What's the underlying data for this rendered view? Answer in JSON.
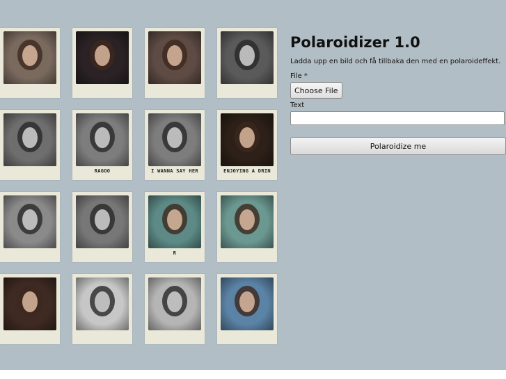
{
  "app": {
    "title": "Polaroidizer 1.0",
    "description": "Ladda upp en bild och få tillbaka den med en polaroideffekt."
  },
  "form": {
    "file_label": "File *",
    "choose_file_label": "Choose File",
    "text_label": "Text",
    "text_value": "",
    "submit_label": "Polaroidize me"
  },
  "gallery": [
    {
      "caption": "",
      "bg": "#7a6a5e",
      "mono": false
    },
    {
      "caption": "",
      "bg": "#2a2224",
      "mono": false
    },
    {
      "caption": "",
      "bg": "#5e4b44",
      "mono": false
    },
    {
      "caption": "",
      "bg": "#5a5a5a",
      "mono": true
    },
    {
      "caption": "",
      "bg": "#6e6e6e",
      "mono": true
    },
    {
      "caption": "RAGOO",
      "bg": "#7d7d7d",
      "mono": true
    },
    {
      "caption": "I WANNA SAY HER",
      "bg": "#7d7d7d",
      "mono": true
    },
    {
      "caption": "ENJOYING A DRIN",
      "bg": "#2c2018",
      "mono": false
    },
    {
      "caption": "",
      "bg": "#8a8a8a",
      "mono": true
    },
    {
      "caption": "",
      "bg": "#777777",
      "mono": true
    },
    {
      "caption": "R",
      "bg": "#5d8a86",
      "mono": false
    },
    {
      "caption": "",
      "bg": "#6b9890",
      "mono": false
    },
    {
      "caption": "",
      "bg": "#3e2a22",
      "mono": false
    },
    {
      "caption": "",
      "bg": "#c7c7c7",
      "mono": true
    },
    {
      "caption": "",
      "bg": "#b5b5b5",
      "mono": true
    },
    {
      "caption": "",
      "bg": "#5b83a6",
      "mono": false
    }
  ],
  "colors": {
    "background": "#b2bec5",
    "polaroid_frame": "#e9e8d9"
  }
}
